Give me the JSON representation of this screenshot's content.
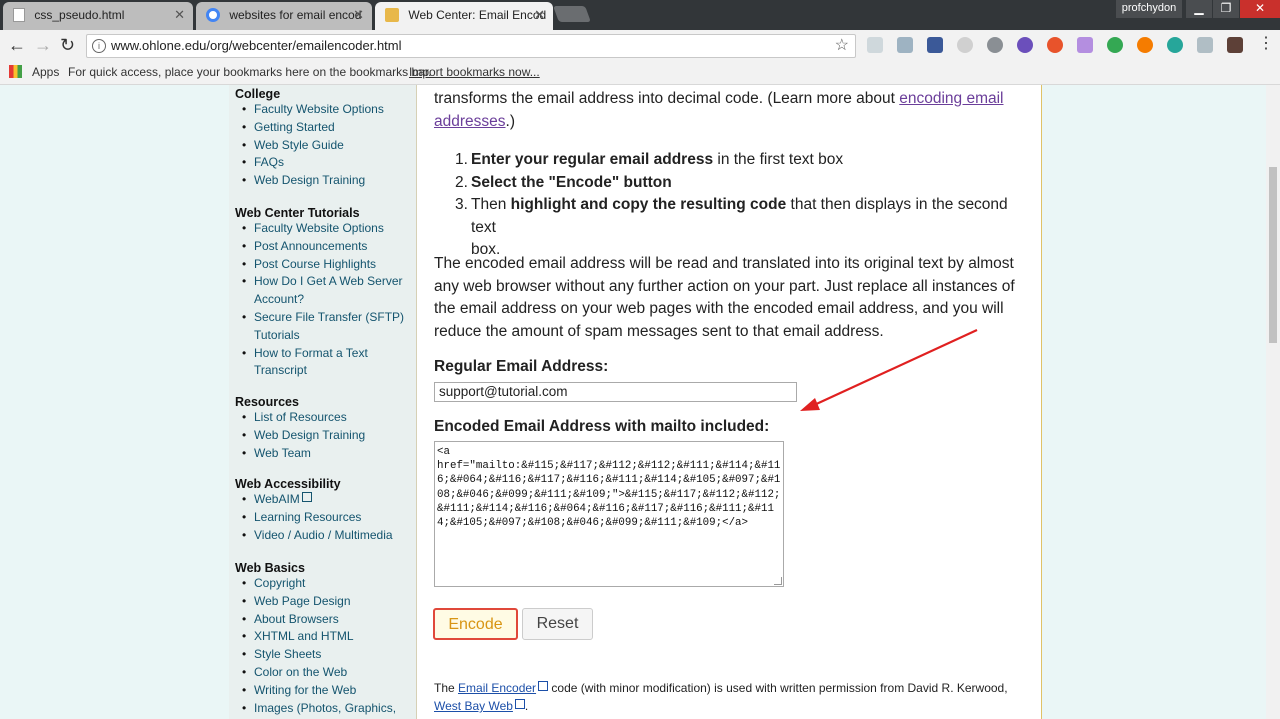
{
  "browser": {
    "tabs": [
      {
        "title": "css_pseudo.html",
        "active": false
      },
      {
        "title": "websites for email encod",
        "active": false
      },
      {
        "title": "Web Center: Email Encod",
        "active": true
      }
    ],
    "user": "profchydon",
    "url": "www.ohlone.edu/org/webcenter/emailencoder.html",
    "bookmarks_bar": {
      "apps": "Apps",
      "message": "For quick access, place your bookmarks here on the bookmarks bar.",
      "import_link": "Import bookmarks now..."
    }
  },
  "sidebar": {
    "sections": [
      {
        "title": "College",
        "items": [
          "Faculty Website Options",
          "Getting Started",
          "Web Style Guide",
          "FAQs",
          "Web Design Training"
        ]
      },
      {
        "title": "Web Center Tutorials",
        "items": [
          "Faculty Website Options",
          "Post Announcements",
          "Post Course Highlights",
          "How Do I Get A Web Server",
          "Account?",
          "Secure File Transfer (SFTP)",
          "Tutorials",
          "How to Format a Text",
          "Transcript"
        ]
      },
      {
        "title": "Resources",
        "items": [
          "List of Resources",
          "Web Design Training",
          "Web Team"
        ]
      },
      {
        "title": "Web Accessibility",
        "items": [
          "WebAIM",
          "Learning Resources",
          "Video / Audio / Multimedia"
        ]
      },
      {
        "title": "Web Basics",
        "items": [
          "Copyright",
          "Web Page Design",
          "About Browsers",
          "XHTML and HTML",
          "Style Sheets",
          "Color on the Web",
          "Writing for the Web",
          "Images (Photos, Graphics,"
        ]
      }
    ]
  },
  "content": {
    "intro_line1": "transforms the email address into decimal code. (Learn more about ",
    "intro_link_a": "encoding email",
    "intro_link_b": "addresses",
    "intro_end": ".)",
    "steps": [
      {
        "num": "1.",
        "bold": "Enter your regular email address",
        "rest": " in the first text box"
      },
      {
        "num": "2.",
        "bold": "Select the \"Encode\" button",
        "rest": ""
      },
      {
        "num": "3.",
        "pre": "Then ",
        "bold": "highlight and copy the resulting code",
        "rest": " that then displays in the second text",
        "cont": "box."
      }
    ],
    "description": "The encoded email address will be read and translated into its original text by almost any web browser without any further action on your part. Just replace all instances of the email address on your web pages with the encoded email address, and you will reduce the amount of spam messages sent to that email address.",
    "regular_label": "Regular Email Address:",
    "regular_value": "support@tutorial.com",
    "encoded_label": "Encoded Email Address with mailto included:",
    "encoded_value": "<a\nhref=\"mailto:&#115;&#117;&#112;&#112;&#111;&#114;&#116;&#064;&#116;&#117;&#116;&#111;&#114;&#105;&#097;&#108;&#046;&#099;&#111;&#109;\">&#115;&#117;&#112;&#112;&#111;&#114;&#116;&#064;&#116;&#117;&#116;&#111;&#114;&#105;&#097;&#108;&#046;&#099;&#111;&#109;</a>",
    "encode_button": "Encode",
    "reset_button": "Reset",
    "credit_pre": "The ",
    "credit_link": "Email Encoder",
    "credit_mid": " code (with minor modification) is used with written permission from David R. Kerwood,",
    "credit_link2": "West Bay Web",
    "credit_end": "."
  }
}
